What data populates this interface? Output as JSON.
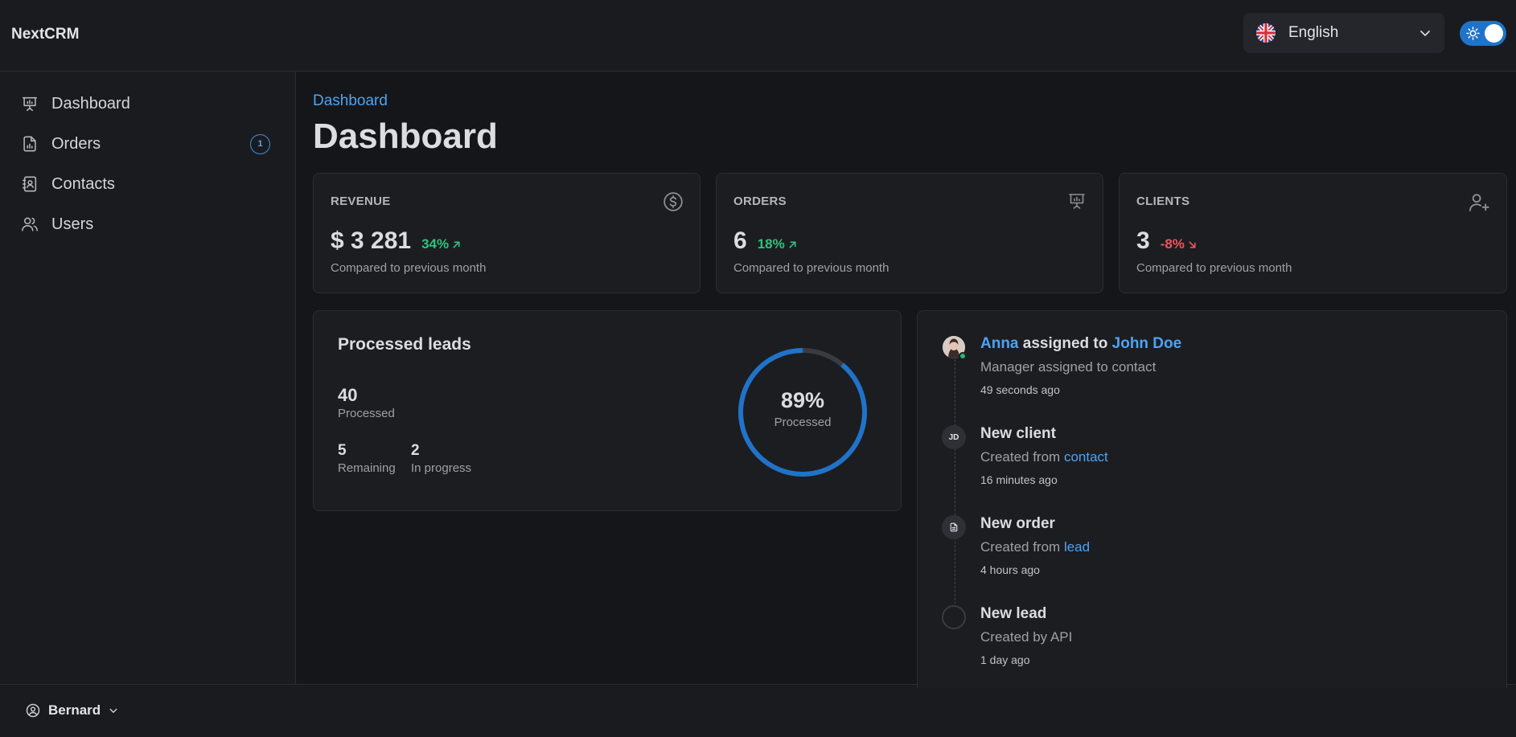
{
  "header": {
    "brand": "NextCRM",
    "language": {
      "selected": "English",
      "flag_icon": "uk-flag-icon"
    },
    "theme_toggle": {
      "icon": "sun-icon",
      "state": "on"
    }
  },
  "sidebar": {
    "items": [
      {
        "label": "Dashboard",
        "icon": "presentation-chart-icon"
      },
      {
        "label": "Orders",
        "icon": "document-chart-icon",
        "badge": "1"
      },
      {
        "label": "Contacts",
        "icon": "address-book-icon"
      },
      {
        "label": "Users",
        "icon": "users-icon"
      }
    ]
  },
  "user": {
    "name": "Bernard"
  },
  "main": {
    "breadcrumb": "Dashboard",
    "title": "Dashboard",
    "stats": [
      {
        "title": "REVENUE",
        "value": "$ 3 281",
        "delta": "34%",
        "trend": "up",
        "note": "Compared to previous month",
        "icon": "dollar-circle-icon"
      },
      {
        "title": "ORDERS",
        "value": "6",
        "delta": "18%",
        "trend": "up",
        "note": "Compared to previous month",
        "icon": "presentation-chart-icon"
      },
      {
        "title": "CLIENTS",
        "value": "3",
        "delta": "-8%",
        "trend": "down",
        "note": "Compared to previous month",
        "icon": "user-plus-icon"
      }
    ],
    "leads": {
      "title": "Processed leads",
      "processed_value": "40",
      "processed_label": "Processed",
      "remaining_value": "5",
      "remaining_label": "Remaining",
      "in_progress_value": "2",
      "in_progress_label": "In progress",
      "ring_percent": 89,
      "ring_percent_text": "89%",
      "ring_label": "Processed"
    },
    "activity": [
      {
        "actor": "Anna",
        "verb": " assigned to ",
        "target": "John Doe",
        "desc": "Manager assigned to contact",
        "time": "49 seconds ago"
      },
      {
        "title": "New client",
        "initials": "JD",
        "desc_prefix": "Created from ",
        "desc_link": "contact",
        "time": "16 minutes ago"
      },
      {
        "title": "New order",
        "icon": "document-icon",
        "desc_prefix": "Created from ",
        "desc_link": "lead",
        "time": "4 hours ago"
      },
      {
        "title": "New lead",
        "desc": "Created by API",
        "time": "1 day ago"
      }
    ]
  },
  "colors": {
    "accent": "#1f73c9",
    "link": "#4da3f3",
    "positive": "#2fc27a",
    "negative": "#f0545c"
  }
}
